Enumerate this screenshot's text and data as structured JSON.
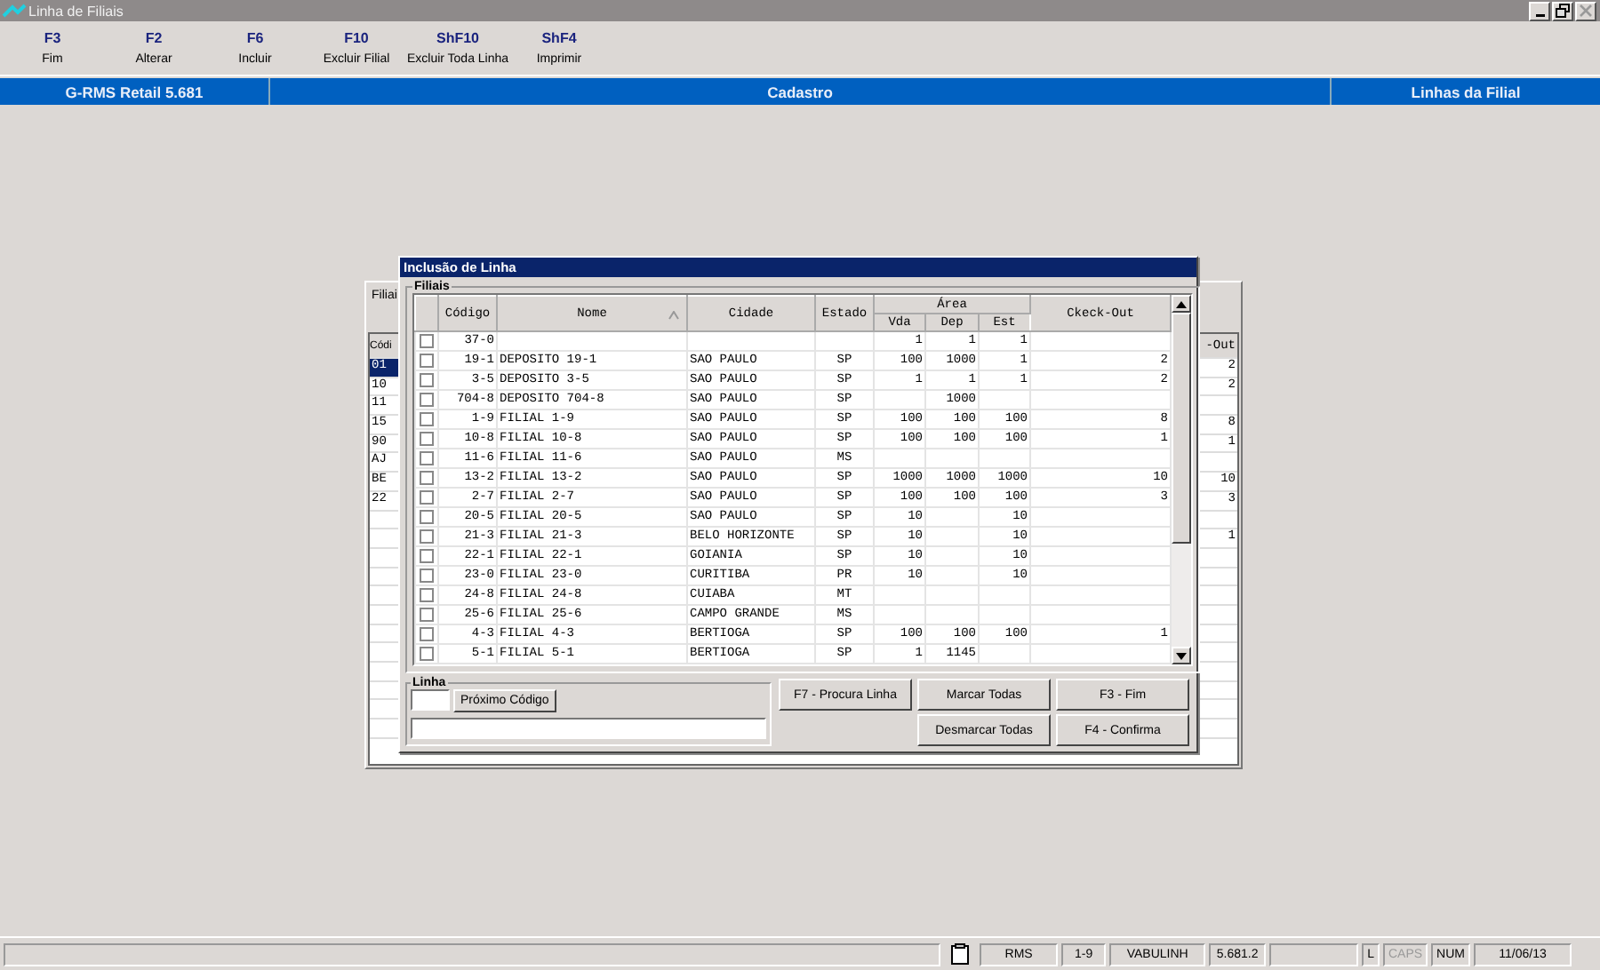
{
  "window": {
    "title": "Linha de Filiais"
  },
  "toolbar": [
    {
      "key": "F3",
      "label": "Fim"
    },
    {
      "key": "F2",
      "label": "Alterar"
    },
    {
      "key": "F6",
      "label": "Incluir"
    },
    {
      "key": "F10",
      "label": "Excluir Filial"
    },
    {
      "key": "ShF10",
      "label": "Excluir Toda Linha"
    },
    {
      "key": "ShF4",
      "label": "Imprimir"
    }
  ],
  "header_bar": [
    "G-RMS Retail 5.681",
    "Cadastro",
    "Linhas da Filial"
  ],
  "background_panel": {
    "tab": "Filiai",
    "column_1_header": "Códi",
    "column_last_header": "-Out",
    "rows": [
      {
        "column_1": "01",
        "column_last": "2",
        "selected": true
      },
      {
        "column_1": "10",
        "column_last": "2",
        "selected": false
      },
      {
        "column_1": "11",
        "selected": false
      },
      {
        "column_1": "15",
        "column_last": "8",
        "selected": false
      },
      {
        "column_1": "90",
        "column_last": "1",
        "selected": false
      },
      {
        "column_1": "AJ",
        "selected": false
      },
      {
        "column_1": "BE",
        "column_last": "10",
        "selected": false
      },
      {
        "column_1": "22",
        "column_last": "3",
        "selected": false
      },
      {
        "selected": false
      },
      {
        "column_last": "1",
        "selected": false
      },
      {
        "selected": false
      },
      {
        "selected": false
      },
      {
        "selected": false
      },
      {
        "selected": false
      },
      {
        "selected": false
      },
      {
        "selected": false
      },
      {
        "selected": false
      },
      {
        "selected": false
      },
      {
        "selected": false
      },
      {
        "selected": false
      }
    ]
  },
  "dialog": {
    "title": "Inclusão de Linha",
    "group": "Filiais",
    "columns": {
      "codigo": "Código",
      "nome": "Nome",
      "cidade": "Cidade",
      "estado": "Estado",
      "area": "Área",
      "vda": "Vda",
      "dep": "Dep",
      "est": "Est",
      "checkout": "Ckeck-Out"
    },
    "rows": [
      {
        "checked": false,
        "codigo": "37-0",
        "vda": "1",
        "dep": "1",
        "est": "1"
      },
      {
        "checked": false,
        "codigo": "19-1",
        "nome": "DEPOSITO 19-1",
        "cidade": "SAO PAULO",
        "estado": "SP",
        "vda": "100",
        "dep": "1000",
        "est": "1",
        "checkout": "2"
      },
      {
        "checked": false,
        "codigo": "3-5",
        "nome": "DEPOSITO 3-5",
        "cidade": "SAO PAULO",
        "estado": "SP",
        "vda": "1",
        "dep": "1",
        "est": "1",
        "checkout": "2"
      },
      {
        "checked": false,
        "codigo": "704-8",
        "nome": "DEPOSITO 704-8",
        "cidade": "SAO PAULO",
        "estado": "SP",
        "dep": "1000"
      },
      {
        "checked": false,
        "codigo": "1-9",
        "nome": "FILIAL 1-9",
        "cidade": "SAO PAULO",
        "estado": "SP",
        "vda": "100",
        "dep": "100",
        "est": "100",
        "checkout": "8"
      },
      {
        "checked": false,
        "codigo": "10-8",
        "nome": "FILIAL 10-8",
        "cidade": "SAO PAULO",
        "estado": "SP",
        "vda": "100",
        "dep": "100",
        "est": "100",
        "checkout": "1"
      },
      {
        "checked": false,
        "codigo": "11-6",
        "nome": "FILIAL 11-6",
        "cidade": "SAO PAULO",
        "estado": "MS"
      },
      {
        "checked": false,
        "codigo": "13-2",
        "nome": "FILIAL 13-2",
        "cidade": "SAO PAULO",
        "estado": "SP",
        "vda": "1000",
        "dep": "1000",
        "est": "1000",
        "checkout": "10"
      },
      {
        "checked": false,
        "codigo": "2-7",
        "nome": "FILIAL 2-7",
        "cidade": "SAO PAULO",
        "estado": "SP",
        "vda": "100",
        "dep": "100",
        "est": "100",
        "checkout": "3"
      },
      {
        "checked": false,
        "codigo": "20-5",
        "nome": "FILIAL 20-5",
        "cidade": "SAO PAULO",
        "estado": "SP",
        "vda": "10",
        "est": "10"
      },
      {
        "checked": false,
        "codigo": "21-3",
        "nome": "FILIAL 21-3",
        "cidade": "BELO HORIZONTE",
        "estado": "SP",
        "vda": "10",
        "est": "10"
      },
      {
        "checked": false,
        "codigo": "22-1",
        "nome": "FILIAL 22-1",
        "cidade": "GOIANIA",
        "estado": "SP",
        "vda": "10",
        "est": "10"
      },
      {
        "checked": false,
        "codigo": "23-0",
        "nome": "FILIAL 23-0",
        "cidade": "CURITIBA",
        "estado": "PR",
        "vda": "10",
        "est": "10"
      },
      {
        "checked": false,
        "codigo": "24-8",
        "nome": "FILIAL 24-8",
        "cidade": "CUIABA",
        "estado": "MT"
      },
      {
        "checked": false,
        "codigo": "25-6",
        "nome": "FILIAL 25-6",
        "cidade": "CAMPO GRANDE",
        "estado": "MS"
      },
      {
        "checked": false,
        "codigo": "4-3",
        "nome": "FILIAL 4-3",
        "cidade": "BERTIOGA",
        "estado": "SP",
        "vda": "100",
        "dep": "100",
        "est": "100",
        "checkout": "1"
      },
      {
        "checked": false,
        "codigo": "5-1",
        "nome": "FILIAL 5-1",
        "cidade": "BERTIOGA",
        "estado": "SP",
        "vda": "1",
        "dep": "1145"
      }
    ],
    "linha_group": "Linha",
    "next_code_button": "Próximo Código",
    "buttons": {
      "search": "F7 - Procura Linha",
      "mark_all": "Marcar Todas",
      "end": "F3 - Fim",
      "unmark_all": "Desmarcar Todas",
      "confirm": "F4 - Confirma"
    }
  },
  "status_bar": {
    "fields": [
      "RMS",
      "1-9",
      "VABULINH",
      "5.681.2"
    ],
    "indicators": [
      {
        "label": "L",
        "on": true
      },
      {
        "label": "CAPS",
        "on": false
      },
      {
        "label": "NUM",
        "on": true
      }
    ],
    "date": "11/06/13"
  }
}
